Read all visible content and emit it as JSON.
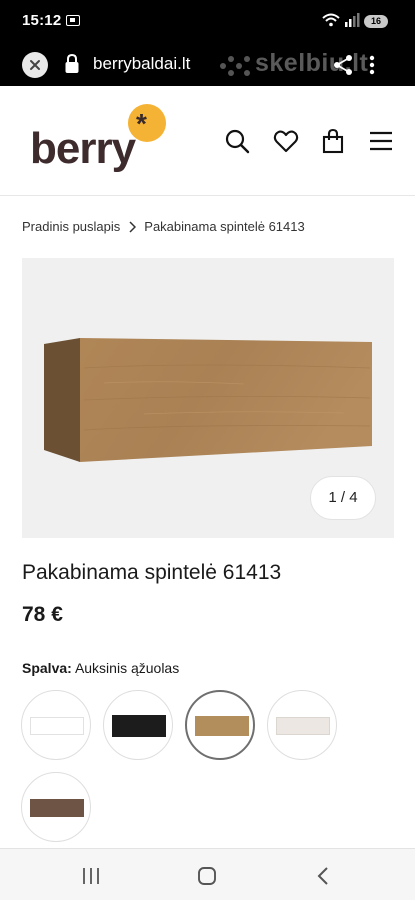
{
  "status": {
    "time": "15:12",
    "battery": "16"
  },
  "browser": {
    "url": "berrybaldai.lt",
    "watermark": "skelbiu.lt"
  },
  "site": {
    "logo_text": "berry",
    "logo_mark": "*",
    "brand_color": "#f5b335",
    "brand_text_color": "#3e2b2e"
  },
  "breadcrumb": {
    "home": "Pradinis puslapis",
    "current": "Pakabinama spintelė 61413"
  },
  "gallery": {
    "counter": "1 / 4"
  },
  "product": {
    "title": "Pakabinama spintelė 61413",
    "price": "78 €",
    "color_label": "Spalva:",
    "color_value": "Auksinis ąžuolas"
  },
  "swatches": [
    {
      "color": "#ffffff",
      "selected": false
    },
    {
      "color": "#1c1c1c",
      "selected": false
    },
    {
      "color": "#b38e5d",
      "selected": true
    },
    {
      "color": "#ece7e3",
      "selected": false
    },
    {
      "color": "#6e5444",
      "selected": false
    }
  ]
}
